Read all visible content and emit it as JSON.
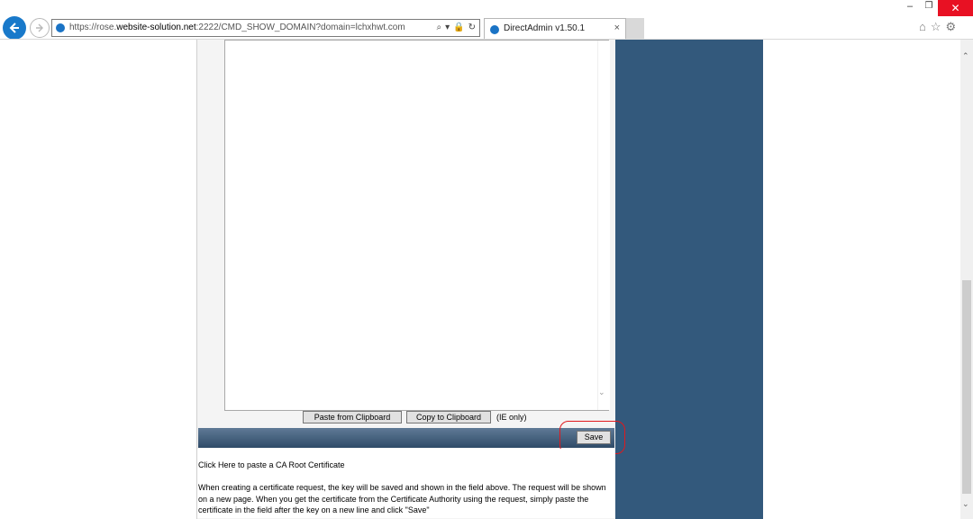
{
  "browser": {
    "url_prefix": "https://rose.",
    "url_domain": "website-solution.net",
    "url_rest": ":2222/CMD_SHOW_DOMAIN?domain=lchxhwt.com",
    "tab_title": "DirectAdmin v1.50.1",
    "tab_close": "×",
    "address_tools": [
      "⌕",
      "▾",
      "🔒",
      "↻"
    ],
    "window_controls": {
      "minimize": "–",
      "restore": "❐",
      "close": "✕"
    },
    "right_icons": "⌂☆⚙"
  },
  "form": {
    "textarea_value": "",
    "paste_button": "Paste from Clipboard",
    "copy_button": "Copy to Clipboard",
    "ie_only": "(IE only)",
    "save_button": "Save"
  },
  "content": {
    "ca_link": "Click Here to paste a CA Root Certificate",
    "help_text": "When creating a certificate request, the key will be saved and shown in the field above. The request will be shown on a new page. When you get the certificate from the Certificate Authority using the request, simply paste the certificate in the field after the key on a new line and click \"Save\""
  },
  "colors": {
    "sidebar": "#33597c",
    "save_bar_top": "#5f7a96",
    "save_bar_bottom": "#2f4b68",
    "highlight": "#e0191d",
    "browser_accent": "#1979ca"
  }
}
